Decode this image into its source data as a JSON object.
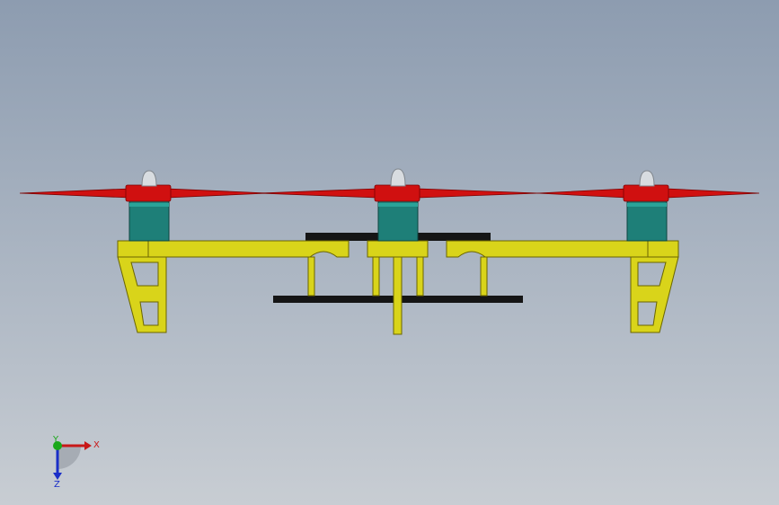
{
  "viewport": {
    "background_top": "#8d9cb0",
    "background_bottom": "#c8cdd3"
  },
  "model": {
    "colors": {
      "propeller": "#d01010",
      "motor": "#1e7f78",
      "frame": "#d9d41a",
      "frame_edge": "#6a6500",
      "plate": "#151515",
      "spinner": "#d8dce0"
    }
  },
  "triad": {
    "x_label": "X",
    "y_label": "Y",
    "z_label": "Z",
    "x_color": "#c81818",
    "y_color": "#1aa81a",
    "z_color": "#1a2ec8"
  }
}
